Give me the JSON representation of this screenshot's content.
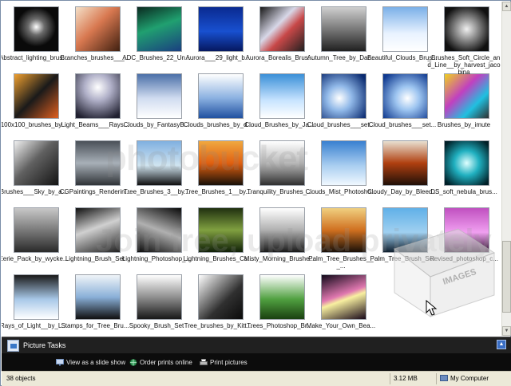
{
  "tiles": [
    {
      "caption": "Abstract_lighting_brus...",
      "bg": "radial-gradient(circle at 50% 45%, #ffffff 0%, #6a6a6a 25%, #0a0a0a 60%)"
    },
    {
      "caption": "Branches_brushes___...",
      "bg": "linear-gradient(135deg, #f4e0c8 0%, #d87850 45%, #402010 100%)"
    },
    {
      "caption": "ADC_Brushes_22_Un...",
      "bg": "linear-gradient(160deg, #0a2a20 0%, #20a070 45%, #1a3f80 100%)"
    },
    {
      "caption": "Aurora___29_light_b...",
      "bg": "linear-gradient(180deg, #0a2a90 0%, #1850d0 55%, #061860 100%)"
    },
    {
      "caption": "Aurora_Borealis_Brus...",
      "bg": "linear-gradient(135deg, #181818 0%, #d8d8e8 40%, #c84848 60%, #202020 100%)"
    },
    {
      "caption": "Autumn_Tree_by_Dar...",
      "bg": "linear-gradient(180deg, #cfcfcf 0%, #707070 55%, #202020 100%)"
    },
    {
      "caption": "Beautiful_Clouds_Brus...",
      "bg": "linear-gradient(180deg, #7ab0e8 0%, #e8f2ff 60%, #ffffff 100%)"
    },
    {
      "caption": "_Brushes_Soft_Circle_and_Line__by_harvest_jacobina",
      "bg": "radial-gradient(circle at 50% 50%, #f0f0f0 0%, #808080 40%, #101010 80%)"
    },
    {
      "caption": "100x100_brushes_by...",
      "bg": "linear-gradient(135deg, #f0a030 0%, #1a1a1a 50%, #e06020 100%)"
    },
    {
      "caption": "Light_Beams___Rays...",
      "bg": "radial-gradient(circle at 50% 30%, #ffffff 0%, #b0b0c8 35%, #202030 90%)"
    },
    {
      "caption": "Clouds_by_FantasyB...",
      "bg": "linear-gradient(180deg, #4a6fa8 0%, #d0dcf0 55%, #ffffff 100%)"
    },
    {
      "caption": "Clouds_brushes_by_d...",
      "bg": "linear-gradient(180deg, #ffffff 0%, #8ab0e0 55%, #2050a0 100%)"
    },
    {
      "caption": "Cloud_Brushes_by_Ja...",
      "bg": "linear-gradient(180deg, #3a90d8 0%, #c8e4ff 60%, #ffffff 100%)"
    },
    {
      "caption": "Cloud_brushes___set...",
      "bg": "radial-gradient(circle at 40% 55%, #ffffff 0%, #90b8e8 35%, #0a2a70 90%)"
    },
    {
      "caption": "Cloud_brushes___set...",
      "bg": "radial-gradient(circle at 55% 55%, #ffffff 0%, #9cc4f0 35%, #103a90 90%)"
    },
    {
      "caption": "Brushes_by_imute",
      "bg": "linear-gradient(135deg, #f0d020 0%, #c040c0 40%, #20c0e0 70%, #303030 100%)"
    },
    {
      "caption": "Brushes___Sky_by_a...",
      "bg": "linear-gradient(135deg, #f0f0f0 0%, #606060 45%, #141414 100%)"
    },
    {
      "caption": "CGPaintings_Renderin...",
      "bg": "linear-gradient(180deg, #4a5058 0%, #a8b0b8 50%, #303438 100%)"
    },
    {
      "caption": "Tree_Brushes_3__by...",
      "bg": "linear-gradient(180deg, #80b0e0 0%, #d0e4f0 55%, #101010 100%)"
    },
    {
      "caption": "Tree_Brushes_1__by...",
      "bg": "linear-gradient(180deg, #f0a840 0%, #e06010 50%, #181008 100%)"
    },
    {
      "caption": "Tranquility_Brushes_...",
      "bg": "linear-gradient(180deg, #ffffff 0%, #b8b8b8 50%, #303030 100%)"
    },
    {
      "caption": "Clouds_Mist_Photosho...",
      "bg": "linear-gradient(180deg, #3880d0 0%, #a8cdf0 55%, #f0f8ff 100%)"
    },
    {
      "caption": "Cloudy_Day_by_Bleed...",
      "bg": "linear-gradient(180deg, #e8e0d0 0%, #b04010 50%, #201008 100%)"
    },
    {
      "caption": "DS_soft_nebula_brus...",
      "bg": "radial-gradient(circle at 50% 50%, #e0ffff 0%, #20b0c0 40%, #002028 90%)"
    },
    {
      "caption": "Eerie_Pack_by_wycke...",
      "bg": "linear-gradient(180deg, #c8c8c8 0%, #7a7a7a 50%, #2a2a2a 100%)"
    },
    {
      "caption": "Lightning_Brush_Set",
      "bg": "linear-gradient(160deg, #101010 0%, #d0d0d0 45%, #202020 100%)"
    },
    {
      "caption": "Lightning_Photoshop_...",
      "bg": "linear-gradient(200deg, #0a0a0a 0%, #b0b0b0 50%, #0a0a0a 100%)"
    },
    {
      "caption": "Lightning_Brushes_Cs...",
      "bg": "linear-gradient(180deg, #203010 0%, #80a040 50%, #102008 100%)"
    },
    {
      "caption": "Misty_Morning_Brushe...",
      "bg": "linear-gradient(180deg, #ffffff 0%, #b0b0b0 50%, #1a1a1a 100%)"
    },
    {
      "caption": "Palm_Tree_Brushes___...",
      "bg": "linear-gradient(180deg, #f0d080 0%, #d07020 50%, #1a1008 100%)"
    },
    {
      "caption": "Palm_Tree_Brush_Set",
      "bg": "linear-gradient(180deg, #60b0e8 0%, #a0d0f0 55%, #102030 100%)"
    },
    {
      "caption": "Revised_photoshop_c...",
      "bg": "linear-gradient(180deg, #c050c0 0%, #f0a0f0 55%, #301030 100%)"
    },
    {
      "caption": "Rays_of_Light__by_L...",
      "bg": "linear-gradient(180deg, #1a1a1a 0%, #a8c8e8 55%, #ffffff 100%)"
    },
    {
      "caption": "Stamps_for_Tree_Bru...",
      "bg": "linear-gradient(180deg, #f0f4f8 0%, #8ab0d8 50%, #101010 100%)"
    },
    {
      "caption": "Spooky_Brush_Set",
      "bg": "linear-gradient(180deg, #ffffff 0%, #909090 50%, #181818 100%)"
    },
    {
      "caption": "Tree_brushes_by_Kitt...",
      "bg": "linear-gradient(135deg, #ffffff 0%, #303030 60%, #0a0a0a 100%)"
    },
    {
      "caption": "Trees_Photoshop_Br...",
      "bg": "linear-gradient(180deg, #ffffff 0%, #50a040 55%, #1a4010 100%)"
    },
    {
      "caption": "Make_Your_Own_Bea...",
      "bg": "linear-gradient(160deg, #100818 0%, #e078b0 45%, #f8f0a0 55%, #180818 100%)"
    }
  ],
  "watermark": {
    "line1": "photobucket",
    "line2": "Join free, upload privately",
    "box": "IMAGES"
  },
  "picture_tasks": {
    "title": "Picture Tasks",
    "collapse_glyph": "▲",
    "items": [
      {
        "label": "View as a slide show"
      },
      {
        "label": "Order prints online"
      },
      {
        "label": "Print pictures"
      }
    ]
  },
  "status": {
    "objects": "38 objects",
    "size": "3.12 MB",
    "location": "My Computer"
  },
  "scroll": {
    "up": "▲",
    "down": "▼"
  }
}
